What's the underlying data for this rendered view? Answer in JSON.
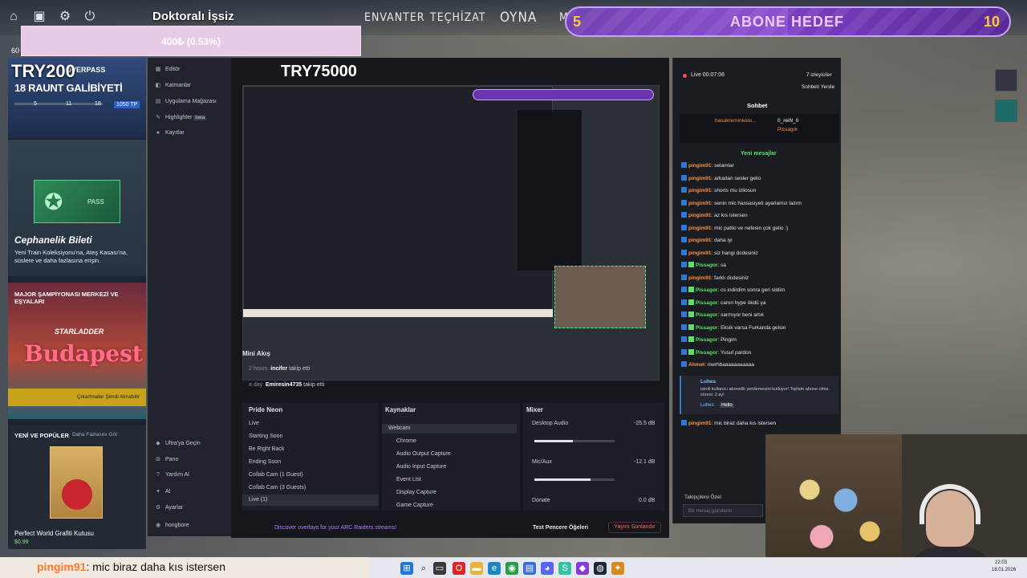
{
  "hud": {
    "title": "Doktoralı İşsiz",
    "donation_text": "400₺ (0.53%)",
    "nav": [
      "ENVANTER",
      "TEÇHİZAT",
      "OYNA",
      "M"
    ],
    "icons": [
      "home-icon",
      "tv-icon",
      "gear-icon",
      "power-icon"
    ]
  },
  "goal": {
    "start": "5",
    "label": "ABONE HEDEF",
    "end": "10",
    "progress": 0.5
  },
  "overlay": {
    "try200": "TRY200",
    "try75000": "TRY75000",
    "hud_left": "60"
  },
  "leftcol": {
    "overpass": "OVERPASS",
    "raunt": "18 RAUNT GALİBİYETİ",
    "raunt_num": "18",
    "nums": [
      "5",
      "11",
      "18"
    ],
    "tp": "1050 TP",
    "pass_label": "PASS",
    "cephane_title": "Cephanelik Bileti",
    "cephane_desc": "Yeni Train Koleksiyonu'na, Ateş Kasası'na, süslere ve daha fazlasına erişin.",
    "major_title": "MAJOR ŞAMPİYONASI MERKEZİ VE EŞYALARI",
    "budapest": "Budapest",
    "starladder": "STARLADDER",
    "cikartma": "Çıkartmalar Şimdi Alınabilir",
    "yeni": "YENİ VE POPÜLER",
    "daha": "Daha Fazlasını Gör",
    "perfect": "Perfect World Grafiti Kutusu",
    "price": "$0.99"
  },
  "sidebar": {
    "items": [
      "Editör",
      "Katmanlar",
      "Uygulama Mağazası",
      "Highlighter",
      "Kayıtlar"
    ],
    "beta": "beta",
    "bottom": [
      "Ultra'ya Geçin",
      "Pano",
      "Yardım Al",
      "AI",
      "Ayarlar",
      "hongbore"
    ]
  },
  "mini": {
    "title": "Mini Akış",
    "events": [
      {
        "time": "2 hours",
        "user": "incifer",
        "action": "takip etti"
      },
      {
        "time": "a day",
        "user": "Emiresin4735",
        "action": "takip etti"
      }
    ]
  },
  "scenes": {
    "title": "Pride Neon",
    "items": [
      "Live",
      "Collab Starting Soon",
      "Be Right Back",
      "Ending Soon",
      "Collab Cam (1 Guest)",
      "Collab Cam (3 Guests)",
      "Live (1)"
    ],
    "display": [
      "Live",
      "Starting Soon",
      "Be Right Back",
      "Ending Soon",
      "Collab Cam (1 Guest)",
      "Collab Cam (3 Guests)",
      "Live (1)"
    ]
  },
  "sources": {
    "title": "Kaynaklar",
    "items": [
      "Webcam",
      "Chrome",
      "Audio Output Capture",
      "Audio Input Capture",
      "Event List",
      "Display Capture",
      "Game Capture"
    ]
  },
  "mixer": {
    "title": "Mixer",
    "channels": [
      {
        "name": "Desktop Audio",
        "db": "-25.5 dB",
        "level": 0.48
      },
      {
        "name": "Mic/Aux",
        "db": "-12.1 dB",
        "level": 0.7
      },
      {
        "name": "Donate",
        "db": "0.0 dB",
        "level": 0
      }
    ]
  },
  "footer": {
    "discover": "Discover overlays for your ARC Raiders streams!",
    "test": "Test Pencere Öğeleri",
    "end": "Yayını Sonlandır"
  },
  "chat": {
    "live": "Live 00:07:06",
    "viewers": "7 izleyiciler",
    "refresh": "Sohbeti Yenile",
    "tab": "Sohbet",
    "top": [
      {
        "user": "basakreminkoru...",
        "n": "2"
      },
      {
        "user": "0_reiN_0",
        "n": "1"
      },
      {
        "user": "Pissagor",
        "n": "1"
      }
    ],
    "new": "Yeni mesajlar",
    "messages": [
      {
        "u": "pingim91",
        "t": "selamlar"
      },
      {
        "u": "pingim91",
        "t": "arkadan sesler gelio"
      },
      {
        "u": "pingim91",
        "t": "shorts mu izliosun"
      },
      {
        "u": "pingim91",
        "t": "senin mic hassasiyeti ayarlamız lazım"
      },
      {
        "u": "pingim91",
        "t": "az kıs istersen"
      },
      {
        "u": "pingim91",
        "t": "mic patlio ve nefesin çok gelio :)"
      },
      {
        "u": "pingim91",
        "t": "daha iyi"
      },
      {
        "u": "pingim91",
        "t": "siz hangi dcdesiniz"
      },
      {
        "u": "Pissagor",
        "t": "sa",
        "g": true
      },
      {
        "u": "pingim91",
        "t": "farklı dcdesiniz"
      },
      {
        "u": "Pissagor",
        "t": "cs indirdim sonra geri sildim",
        "g": true
      },
      {
        "u": "Pissagor",
        "t": "canın hype ökdü ya",
        "g": true
      },
      {
        "u": "Pissagor",
        "t": "sarmıyor beni artık",
        "g": true
      },
      {
        "u": "Pissagor",
        "t": "Eksik varsa Furkanda gelsin",
        "g": true
      },
      {
        "u": "Pissagor",
        "t": "Pingim",
        "g": true
      },
      {
        "u": "Pissagor",
        "t": "Yusuf pardon",
        "g": true
      },
      {
        "u": "Ahmet",
        "t": "merhbaaaaaaaaaaa"
      }
    ],
    "sub_user": "Luhes",
    "sub_text": "isimli kullanıcı abonelik yenilemesini kutluyor! Toplam abone olma süresi: 2 ay!",
    "sub_hello_user": "Luhes:",
    "sub_hello": "Hello",
    "last": {
      "u": "pingim91",
      "t": "mic biraz daha kıs istersen"
    },
    "follow_label": "Takipçilere Özel",
    "placeholder": "Bir mesaj gönderin"
  },
  "ticker": {
    "user": "pingim91",
    "text": ": mic biraz daha kıs istersen"
  },
  "clock": {
    "time": "22:03",
    "date": "18.01.2026"
  },
  "colors": {
    "accent": "#7a3fc0",
    "chat_user": "#ff8f3a",
    "green": "#5de06a",
    "end_button": "#ff6a5a"
  }
}
